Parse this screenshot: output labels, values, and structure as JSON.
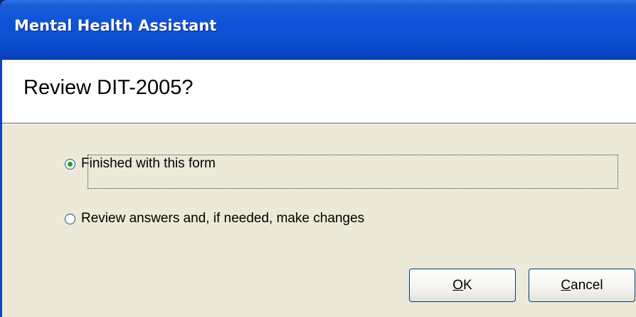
{
  "window": {
    "title": "Mental Health Assistant"
  },
  "header": {
    "heading": "Review DIT-2005?"
  },
  "options": [
    {
      "label": "Finished with this form",
      "selected": true
    },
    {
      "label": "Review answers and, if needed, make changes",
      "selected": false
    }
  ],
  "buttons": {
    "ok_label": "OK",
    "cancel_label": "Cancel"
  },
  "colors": {
    "titlebar": "#0c4fd2",
    "dialog_background": "#ece9d8",
    "radio_dot": "#21a121",
    "button_border": "#003c74"
  }
}
